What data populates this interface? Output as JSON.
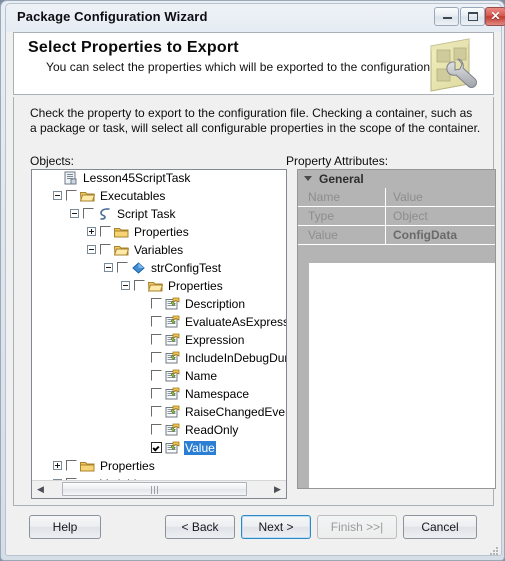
{
  "window": {
    "title": "Package Configuration Wizard",
    "controls": {
      "minimize": "minimize-button",
      "maximize": "maximize-button",
      "close_glyph": "✕"
    }
  },
  "banner": {
    "title": "Select Properties to Export",
    "subtitle": "You can select the properties which will be exported to the configuration file.",
    "icon": "package-wrench-icon"
  },
  "instruction": "Check the property to export to the configuration file. Checking a container, such as a package or task, will select all configurable properties in the scope of the container.",
  "objects": {
    "label": "Objects:",
    "tree": [
      {
        "label": "Lesson45ScriptTask",
        "depth": 0,
        "expander": "none",
        "checkbox": "none",
        "icon": "package-icon"
      },
      {
        "label": "Executables",
        "depth": 1,
        "expander": "minus",
        "checkbox": "unchecked",
        "icon": "folder-open-icon"
      },
      {
        "label": "Script Task",
        "depth": 2,
        "expander": "minus",
        "checkbox": "unchecked",
        "icon": "script-task-icon"
      },
      {
        "label": "Properties",
        "depth": 3,
        "expander": "plus",
        "checkbox": "unchecked",
        "icon": "folder-closed-icon"
      },
      {
        "label": "Variables",
        "depth": 3,
        "expander": "minus",
        "checkbox": "unchecked",
        "icon": "folder-open-icon"
      },
      {
        "label": "strConfigTest",
        "depth": 4,
        "expander": "minus",
        "checkbox": "unchecked",
        "icon": "variable-icon"
      },
      {
        "label": "Properties",
        "depth": 5,
        "expander": "minus",
        "checkbox": "unchecked",
        "icon": "folder-open-icon"
      },
      {
        "label": "Description",
        "depth": 6,
        "expander": "none",
        "checkbox": "unchecked",
        "icon": "property-icon"
      },
      {
        "label": "EvaluateAsExpression",
        "depth": 6,
        "expander": "none",
        "checkbox": "unchecked",
        "icon": "property-icon"
      },
      {
        "label": "Expression",
        "depth": 6,
        "expander": "none",
        "checkbox": "unchecked",
        "icon": "property-icon"
      },
      {
        "label": "IncludeInDebugDump",
        "depth": 6,
        "expander": "none",
        "checkbox": "unchecked",
        "icon": "property-icon"
      },
      {
        "label": "Name",
        "depth": 6,
        "expander": "none",
        "checkbox": "unchecked",
        "icon": "property-icon"
      },
      {
        "label": "Namespace",
        "depth": 6,
        "expander": "none",
        "checkbox": "unchecked",
        "icon": "property-icon"
      },
      {
        "label": "RaiseChangedEvent",
        "depth": 6,
        "expander": "none",
        "checkbox": "unchecked",
        "icon": "property-icon"
      },
      {
        "label": "ReadOnly",
        "depth": 6,
        "expander": "none",
        "checkbox": "unchecked",
        "icon": "property-icon"
      },
      {
        "label": "Value",
        "depth": 6,
        "expander": "none",
        "checkbox": "checked",
        "icon": "property-icon",
        "selected": true
      },
      {
        "label": "Properties",
        "depth": 1,
        "expander": "plus",
        "checkbox": "unchecked",
        "icon": "folder-closed-icon"
      },
      {
        "label": "Variables",
        "depth": 1,
        "expander": "plus",
        "checkbox": "unchecked",
        "icon": "folder-closed-icon"
      }
    ],
    "scrollbar": {
      "left_arrow": "◀",
      "right_arrow": "▶"
    }
  },
  "property_attributes": {
    "label": "Property Attributes:",
    "category": "General",
    "rows": [
      {
        "key": "Name",
        "value": "Value",
        "bold": false
      },
      {
        "key": "Type",
        "value": "Object",
        "bold": false
      },
      {
        "key": "Value",
        "value": "ConfigData",
        "bold": true
      }
    ]
  },
  "footer": {
    "help": "Help",
    "back": "< Back",
    "next": "Next >",
    "finish": "Finish >>|",
    "cancel": "Cancel"
  },
  "colors": {
    "selection_blue": "#2a7fd4",
    "grid_gray": "#b4b4b4",
    "accent_next": "#2b89c8",
    "close_red": "#c4392f"
  }
}
